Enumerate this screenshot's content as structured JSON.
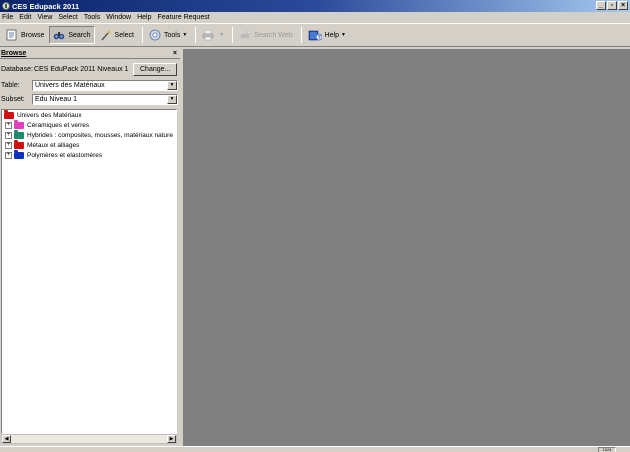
{
  "window": {
    "title": "CES Edupack 2011"
  },
  "menu": [
    "File",
    "Edit",
    "View",
    "Select",
    "Tools",
    "Window",
    "Help",
    "Feature Request"
  ],
  "toolbar": {
    "browse": "Browse",
    "search": "Search",
    "select": "Select",
    "tools": "Tools",
    "search_web": "Search Web",
    "help": "Help"
  },
  "panel": {
    "title": "Browse",
    "close": "×",
    "database_label": "Database:",
    "database_value": "CES EduPack 2011 Niveaux 1 &",
    "change_label": "Change...",
    "table_label": "Table:",
    "table_value": "Univers des Matériaux",
    "subset_label": "Subset:",
    "subset_value": "Edu Niveau 1"
  },
  "tree": {
    "root": "Univers des Matériaux",
    "items": [
      {
        "label": "Céramiques et verres",
        "color": "#e040c0"
      },
      {
        "label": "Hybrides : composites, mousses, matériaux nature",
        "color": "#1a8a6a"
      },
      {
        "label": "Métaux et alliages",
        "color": "#d01010"
      },
      {
        "label": "Polymères et elastomères",
        "color": "#1030c0"
      }
    ],
    "root_color": "#d01010"
  },
  "status": {
    "cell": "1024"
  },
  "colors": {
    "title_gradient_start": "#0a246a",
    "workspace": "#808080",
    "chrome": "#d4d0c8"
  }
}
